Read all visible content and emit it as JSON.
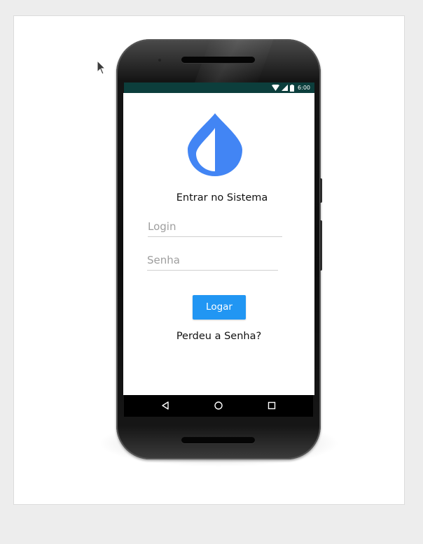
{
  "status_bar": {
    "time": "6:00",
    "icons": [
      "wifi-icon",
      "signal-icon",
      "battery-icon"
    ],
    "background": "#0c3e3c"
  },
  "app": {
    "logo_icon": "water-drop-icon",
    "title": "Entrar no Sistema",
    "login": {
      "placeholder": "Login",
      "value": ""
    },
    "password": {
      "placeholder": "Senha",
      "value": ""
    },
    "submit_label": "Logar",
    "forgot_link": "Perdeu a Senha?"
  },
  "nav_bar": {
    "buttons": [
      "back-icon",
      "home-icon",
      "recents-icon"
    ]
  },
  "colors": {
    "accent": "#2196f3",
    "logo": "#4285f4",
    "page_background": "#ededed",
    "screen_background": "#ffffff"
  }
}
